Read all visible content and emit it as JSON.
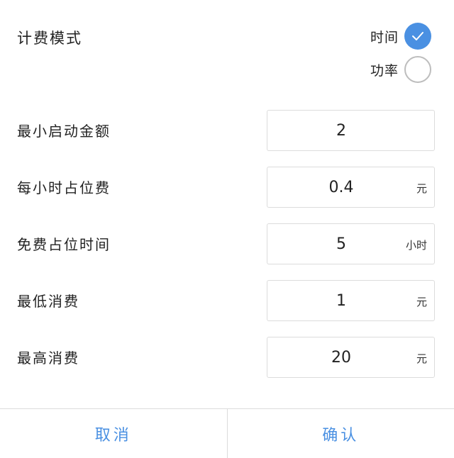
{
  "billing_mode": {
    "label": "计费模式",
    "options": [
      {
        "label": "时间",
        "checked": true
      },
      {
        "label": "功率",
        "checked": false
      }
    ]
  },
  "fields": [
    {
      "label": "最小启动金额",
      "value": "2",
      "unit": ""
    },
    {
      "label": "每小时占位费",
      "value": "0.4",
      "unit": "元"
    },
    {
      "label": "免费占位时间",
      "value": "5",
      "unit": "小时"
    },
    {
      "label": "最低消费",
      "value": "1",
      "unit": "元"
    },
    {
      "label": "最高消费",
      "value": "20",
      "unit": "元"
    }
  ],
  "footer": {
    "cancel_label": "取消",
    "confirm_label": "确认"
  },
  "colors": {
    "accent": "#4a90e2",
    "border": "#dcdcdc"
  }
}
